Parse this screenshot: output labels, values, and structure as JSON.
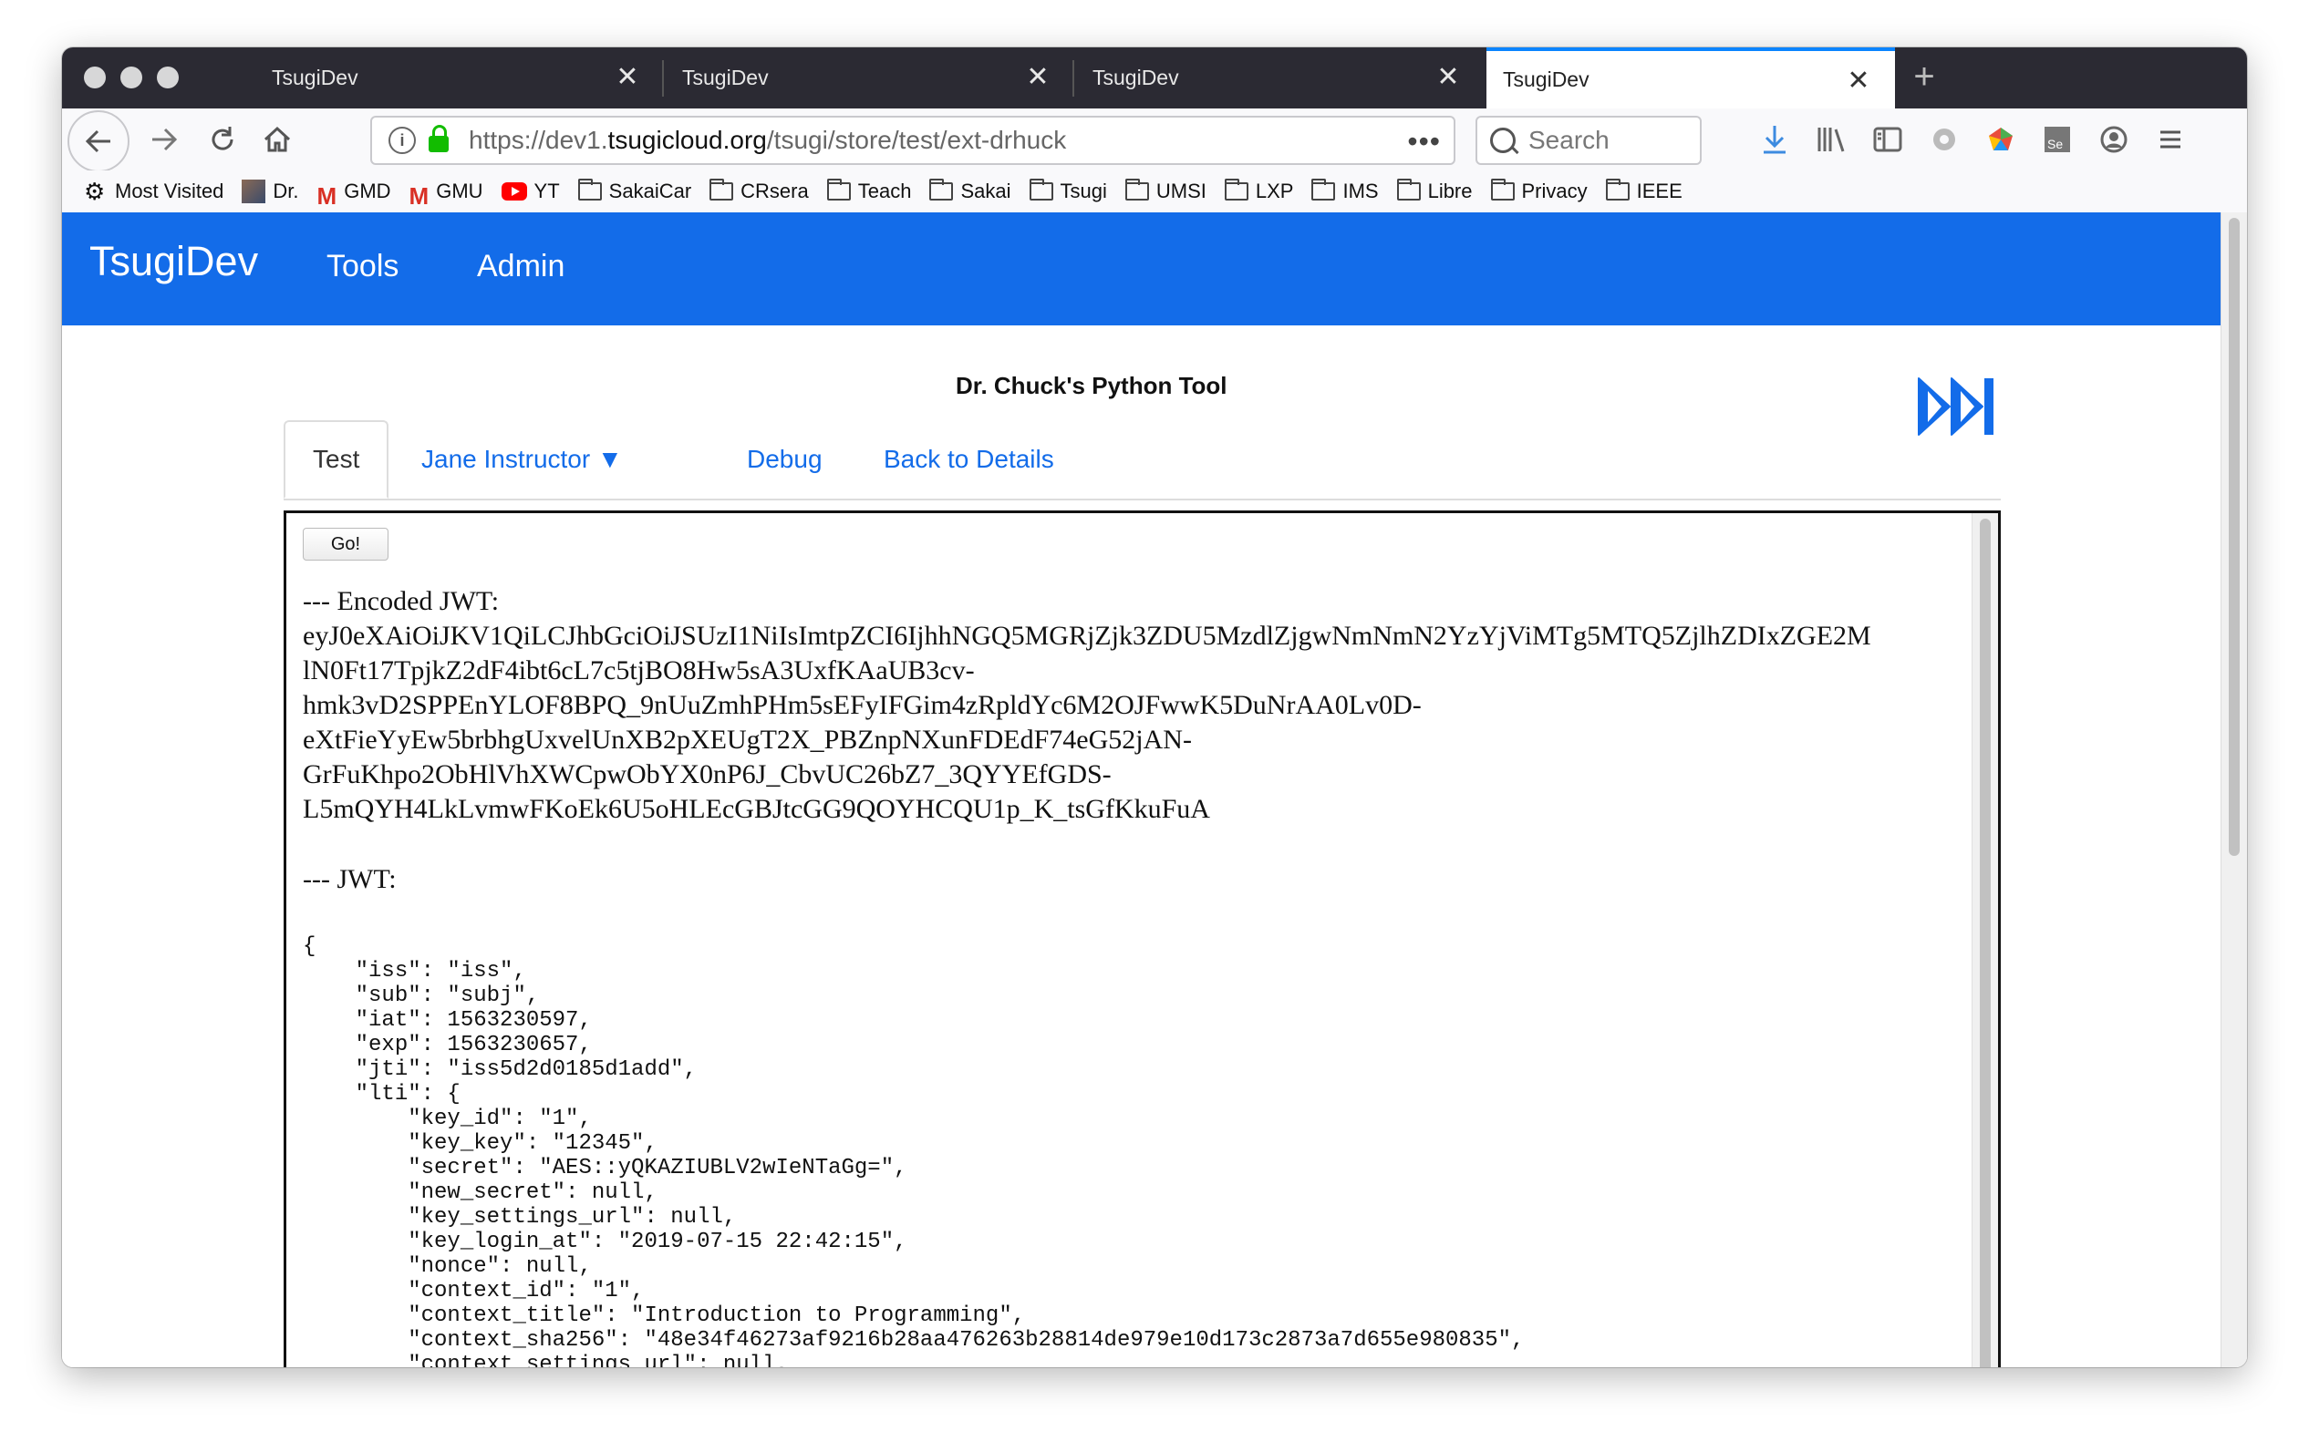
{
  "browser": {
    "tabs": [
      {
        "title": "TsugiDev",
        "active": false
      },
      {
        "title": "TsugiDev",
        "active": false
      },
      {
        "title": "TsugiDev",
        "active": false
      },
      {
        "title": "TsugiDev",
        "active": true
      }
    ],
    "url": {
      "prefix": "https://dev1.",
      "domain": "tsugicloud.org",
      "path": "/tsugi/store/test/ext-drhuck"
    },
    "search_placeholder": "Search",
    "url_menu": "•••",
    "bookmarks": [
      {
        "label": "Most Visited",
        "icon": "gear-icon"
      },
      {
        "label": "Dr.",
        "icon": "avatar-icon"
      },
      {
        "label": "GMD",
        "icon": "gmail-icon"
      },
      {
        "label": "GMU",
        "icon": "gmail-icon"
      },
      {
        "label": "YT",
        "icon": "youtube-icon"
      },
      {
        "label": "SakaiCar",
        "icon": "folder-icon"
      },
      {
        "label": "CRsera",
        "icon": "folder-icon"
      },
      {
        "label": "Teach",
        "icon": "folder-icon"
      },
      {
        "label": "Sakai",
        "icon": "folder-icon"
      },
      {
        "label": "Tsugi",
        "icon": "folder-icon"
      },
      {
        "label": "UMSI",
        "icon": "folder-icon"
      },
      {
        "label": "LXP",
        "icon": "folder-icon"
      },
      {
        "label": "IMS",
        "icon": "folder-icon"
      },
      {
        "label": "Libre",
        "icon": "folder-icon"
      },
      {
        "label": "Privacy",
        "icon": "folder-icon"
      },
      {
        "label": "IEEE",
        "icon": "folder-icon"
      }
    ]
  },
  "colors": {
    "navbar": "#136ce9",
    "link": "#136ce9",
    "tab_accent": "#0a84ff"
  },
  "site": {
    "brand": "TsugiDev",
    "nav": [
      "Tools",
      "Admin"
    ]
  },
  "tool": {
    "title": "Dr. Chuck's Python Tool",
    "tabs": [
      {
        "label": "Test"
      },
      {
        "label": "Jane Instructor ▼"
      },
      {
        "label": "Debug"
      },
      {
        "label": "Back to Details"
      }
    ],
    "go_label": "Go!",
    "encoded_header": "--- Encoded JWT:",
    "encoded_lines": [
      "eyJ0eXAiOiJKV1QiLCJhbGciOiJSUzI1NiIsImtpZCI6IjhhNGQ5MGRjZjk3ZDU5MzdlZjgwNmNmN2YzYjViMTg5MTQ5ZjlhZDIxZGE2M",
      "lN0Ft17TpjkZ2dF4ibt6cL7c5tjBO8Hw5sA3UxfKAaUB3cv-",
      "hmk3vD2SPPEnYLOF8BPQ_9nUuZmhPHm5sEFyIFGim4zRpldYc6M2OJFwwK5DuNrAA0Lv0D-",
      "eXtFieYyEw5brbhgUxvelUnXB2pXEUgT2X_PBZnpNXunFDEdF74eG52jAN-",
      "GrFuKhpo2ObHlVhXWCpwObYX0nP6J_CbvUC26bZ7_3QYYEfGDS-",
      "L5mQYH4LkLvmwFKoEk6U5oHLEcGBJtcGG9QOYHCQU1p_K_tsGfKkuFuA"
    ],
    "jwt_header": "--- JWT:",
    "jwt_body": "{\n    \"iss\": \"iss\",\n    \"sub\": \"subj\",\n    \"iat\": 1563230597,\n    \"exp\": 1563230657,\n    \"jti\": \"iss5d2d0185d1add\",\n    \"lti\": {\n        \"key_id\": \"1\",\n        \"key_key\": \"12345\",\n        \"secret\": \"AES::yQKAZIUBLV2wIeNTaGg=\",\n        \"new_secret\": null,\n        \"key_settings_url\": null,\n        \"key_login_at\": \"2019-07-15 22:42:15\",\n        \"nonce\": null,\n        \"context_id\": \"1\",\n        \"context_title\": \"Introduction to Programming\",\n        \"context_sha256\": \"48e34f46273af9216b28aa476263b28814de979e10d173c2873a7d655e980835\",\n        \"context_settings_url\": null,"
  }
}
